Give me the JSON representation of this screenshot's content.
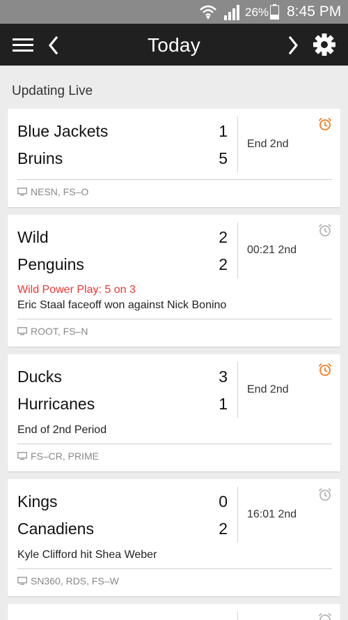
{
  "status_bar": {
    "battery_percent": "26%",
    "time": "8:45 PM"
  },
  "app_bar": {
    "title": "Today"
  },
  "section": {
    "label": "Updating Live"
  },
  "colors": {
    "alarm_active": "#f07c22",
    "alarm_inactive": "#b5b5b5",
    "power_play": "#e53935"
  },
  "games": [
    {
      "away": "Blue Jackets",
      "away_score": "1",
      "home": "Bruins",
      "home_score": "5",
      "period": "End 2nd",
      "power_play": "",
      "last_play": "",
      "tv": "NESN, FS–O",
      "alarm": "alarm-clock-icon-active"
    },
    {
      "away": "Wild",
      "away_score": "2",
      "home": "Penguins",
      "home_score": "2",
      "period": "00:21 2nd",
      "power_play": "Wild Power Play: 5 on 3",
      "last_play": "Eric Staal faceoff won against Nick Bonino",
      "tv": "ROOT, FS–N",
      "alarm": "alarm-clock-icon-inactive"
    },
    {
      "away": "Ducks",
      "away_score": "3",
      "home": "Hurricanes",
      "home_score": "1",
      "period": "End 2nd",
      "power_play": "",
      "last_play": "End of 2nd Period",
      "tv": "FS–CR, PRIME",
      "alarm": "alarm-clock-icon-active"
    },
    {
      "away": "Kings",
      "away_score": "0",
      "home": "Canadiens",
      "home_score": "2",
      "period": "16:01 2nd",
      "power_play": "",
      "last_play": "Kyle Clifford hit Shea Weber",
      "tv": "SN360, RDS, FS–W",
      "alarm": "alarm-clock-icon-inactive"
    }
  ]
}
